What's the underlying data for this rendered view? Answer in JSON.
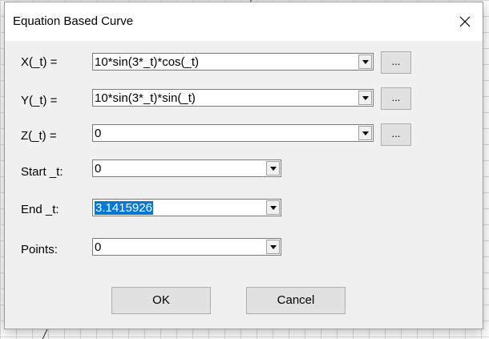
{
  "dialog": {
    "title": "Equation Based Curve",
    "close_icon": "close-icon"
  },
  "fields": {
    "x": {
      "label": "X(_t) =",
      "value": "10*sin(3*_t)*cos(_t)",
      "browse_label": "..."
    },
    "y": {
      "label": "Y(_t) =",
      "value": "10*sin(3*_t)*sin(_t)",
      "browse_label": "..."
    },
    "z": {
      "label": "Z(_t) =",
      "value": "0",
      "browse_label": "..."
    },
    "start_t": {
      "label": "Start _t:",
      "value": "0"
    },
    "end_t": {
      "label": "End _t:",
      "value": "3.1415926"
    },
    "points": {
      "label": "Points:",
      "value": "0"
    }
  },
  "buttons": {
    "ok": "OK",
    "cancel": "Cancel"
  },
  "colors": {
    "selection": "#0078d7",
    "dialog_bg": "#f0f0f0"
  }
}
